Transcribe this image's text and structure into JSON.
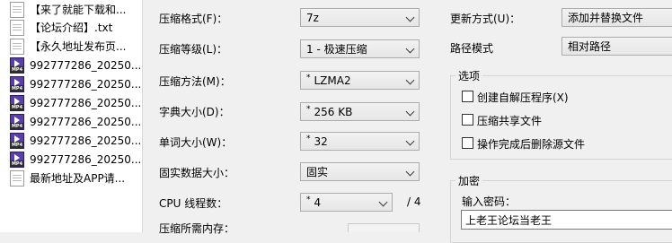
{
  "files": [
    {
      "name": "【来了就能下载和...",
      "type": "doc"
    },
    {
      "name": "【论坛介绍】.txt",
      "type": "doc"
    },
    {
      "name": "【永久地址发布页...",
      "type": "doc"
    },
    {
      "name": "992777286_20250...",
      "type": "mp4"
    },
    {
      "name": "992777286_20250...",
      "type": "mp4"
    },
    {
      "name": "992777286_20250...",
      "type": "mp4"
    },
    {
      "name": "992777286_20250...",
      "type": "mp4"
    },
    {
      "name": "992777286_20250...",
      "type": "mp4"
    },
    {
      "name": "992777286_20250...",
      "type": "mp4"
    },
    {
      "name": "最新地址及APP请...",
      "type": "doc"
    }
  ],
  "mp4_tag": "MP4",
  "settings": {
    "format_label": "压缩格式(F)：",
    "format_value": "7z",
    "level_label": "压缩等级(L)：",
    "level_value": "1 - 极速压缩",
    "method_label": "压缩方法(M)：",
    "method_value": "LZMA2",
    "dict_label": "字典大小(D)：",
    "dict_value": "256 KB",
    "word_label": "单词大小(W)：",
    "word_value": "32",
    "solid_label": "固实数据大小：",
    "solid_value": "固实",
    "cpu_label": "CPU 线程数：",
    "cpu_value": "4",
    "cpu_total": "/ 4",
    "memory_label": "压缩所需内存：",
    "star": "*"
  },
  "right": {
    "update_label": "更新方式(U)：",
    "update_value": "添加并替换文件",
    "path_label": "路径模式",
    "path_value": "相对路径",
    "options_title": "选项",
    "opt_sfx": "创建自解压程序(X)",
    "opt_shared": "压缩共享文件",
    "opt_delete": "操作完成后删除源文件",
    "encrypt_title": "加密",
    "password_label": "输入密码：",
    "password_value": "上老王论坛当老王"
  }
}
